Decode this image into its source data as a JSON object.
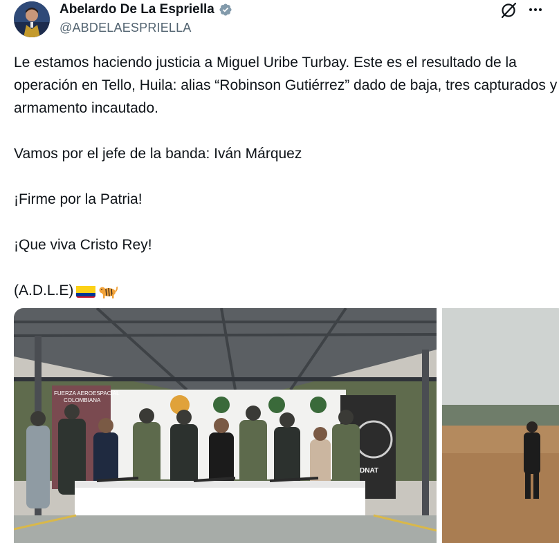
{
  "author": {
    "display_name": "Abelardo De La Espriella",
    "handle": "@ABDELAESPRIELLA",
    "verified": true
  },
  "header_icons": [
    "grok-icon",
    "more-options-icon"
  ],
  "tweet": {
    "paragraph_1": "Le estamos haciendo justicia a Miguel Uribe Turbay. Este es el resultado de la operación en Tello, Huila: alias “Robinson Gutiérrez” dado de baja, tres capturados y armamento incautado.",
    "paragraph_2": "Vamos por el jefe de la banda: Iván Márquez",
    "paragraph_3": "¡Firme por la Patria!",
    "paragraph_4": "¡Que viva Cristo Rey!",
    "signature": "(A.D.L.E)",
    "emojis": [
      "colombia-flag-icon",
      "tiger-icon"
    ]
  },
  "media": {
    "photo_1": {
      "banner_left_line_1": "FUERZA AEROESPACIAL",
      "banner_left_line_2": "COLOMBIANA",
      "banner_right": "DNAT"
    },
    "photo_2": {}
  },
  "colors": {
    "verified": "#829aab",
    "handle": "#536471",
    "text": "#0f1419",
    "flag_yellow": "#fcd116",
    "flag_blue": "#003893",
    "flag_red": "#ce1126"
  }
}
